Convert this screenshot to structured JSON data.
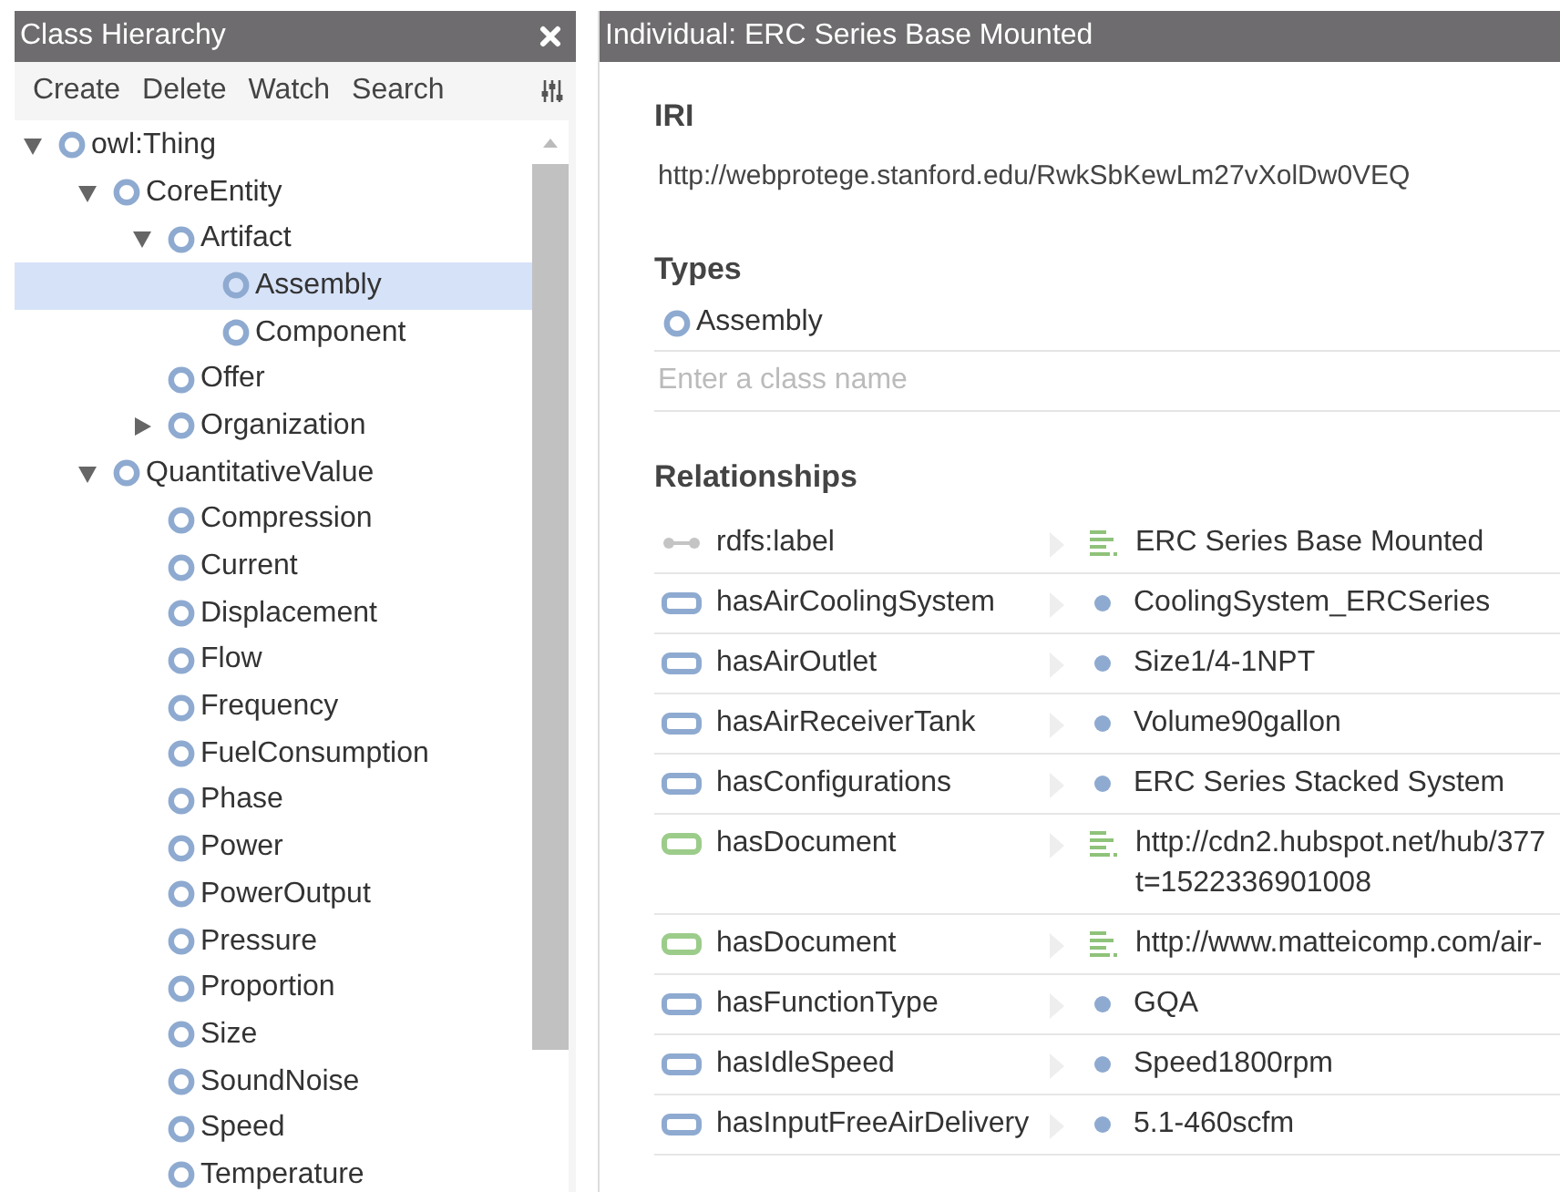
{
  "left_panel": {
    "title": "Class Hierarchy",
    "toolbar": [
      "Create",
      "Delete",
      "Watch",
      "Search"
    ],
    "tree": [
      {
        "label": "owl:Thing",
        "expanded": true,
        "selected": false,
        "children": [
          {
            "label": "CoreEntity",
            "expanded": true,
            "selected": false,
            "children": [
              {
                "label": "Artifact",
                "expanded": true,
                "selected": false,
                "children": [
                  {
                    "label": "Assembly",
                    "selected": true
                  },
                  {
                    "label": "Component",
                    "selected": false
                  }
                ]
              },
              {
                "label": "Offer",
                "selected": false
              },
              {
                "label": "Organization",
                "expanded": false,
                "selected": false
              }
            ]
          },
          {
            "label": "QuantitativeValue",
            "expanded": true,
            "selected": false,
            "children": [
              {
                "label": "Compression",
                "selected": false
              },
              {
                "label": "Current",
                "selected": false
              },
              {
                "label": "Displacement",
                "selected": false
              },
              {
                "label": "Flow",
                "selected": false
              },
              {
                "label": "Frequency",
                "selected": false
              },
              {
                "label": "FuelConsumption",
                "selected": false
              },
              {
                "label": "Phase",
                "selected": false
              },
              {
                "label": "Power",
                "selected": false
              },
              {
                "label": "PowerOutput",
                "selected": false
              },
              {
                "label": "Pressure",
                "selected": false
              },
              {
                "label": "Proportion",
                "selected": false
              },
              {
                "label": "Size",
                "selected": false
              },
              {
                "label": "SoundNoise",
                "selected": false
              },
              {
                "label": "Speed",
                "selected": false
              },
              {
                "label": "Temperature",
                "selected": false
              }
            ]
          }
        ]
      }
    ]
  },
  "right_panel": {
    "title": "Individual: ERC Series Base Mounted",
    "iri_heading": "IRI",
    "iri": "http://webprotege.stanford.edu/RwkSbKewLm27vXolDw0VEQ",
    "types_heading": "Types",
    "types": [
      "Assembly"
    ],
    "types_placeholder": "Enter a class name",
    "relationships_heading": "Relationships",
    "relationships": [
      {
        "property": {
          "kind": "annotation",
          "name": "rdfs:label"
        },
        "value": {
          "kind": "literal",
          "lines": [
            "ERC Series Base Mounted"
          ]
        }
      },
      {
        "property": {
          "kind": "object",
          "name": "hasAirCoolingSystem"
        },
        "value": {
          "kind": "individual",
          "lines": [
            "CoolingSystem_ERCSeries"
          ]
        }
      },
      {
        "property": {
          "kind": "object",
          "name": "hasAirOutlet"
        },
        "value": {
          "kind": "individual",
          "lines": [
            "Size1/4-1NPT"
          ]
        }
      },
      {
        "property": {
          "kind": "object",
          "name": "hasAirReceiverTank"
        },
        "value": {
          "kind": "individual",
          "lines": [
            "Volume90gallon"
          ]
        }
      },
      {
        "property": {
          "kind": "object",
          "name": "hasConfigurations"
        },
        "value": {
          "kind": "individual",
          "lines": [
            "ERC Series Stacked System"
          ]
        }
      },
      {
        "property": {
          "kind": "data",
          "name": "hasDocument"
        },
        "value": {
          "kind": "literal",
          "lines": [
            "http://cdn2.hubspot.net/hub/377",
            "t=1522336901008"
          ]
        }
      },
      {
        "property": {
          "kind": "data",
          "name": "hasDocument"
        },
        "value": {
          "kind": "literal",
          "lines": [
            "http://www.matteicomp.com/air-"
          ]
        }
      },
      {
        "property": {
          "kind": "object",
          "name": "hasFunctionType"
        },
        "value": {
          "kind": "individual",
          "lines": [
            "GQA"
          ]
        }
      },
      {
        "property": {
          "kind": "object",
          "name": "hasIdleSpeed"
        },
        "value": {
          "kind": "individual",
          "lines": [
            "Speed1800rpm"
          ]
        }
      },
      {
        "property": {
          "kind": "object",
          "name": "hasInputFreeAirDelivery"
        },
        "value": {
          "kind": "individual",
          "lines": [
            "5.1-460scfm"
          ]
        }
      }
    ]
  }
}
